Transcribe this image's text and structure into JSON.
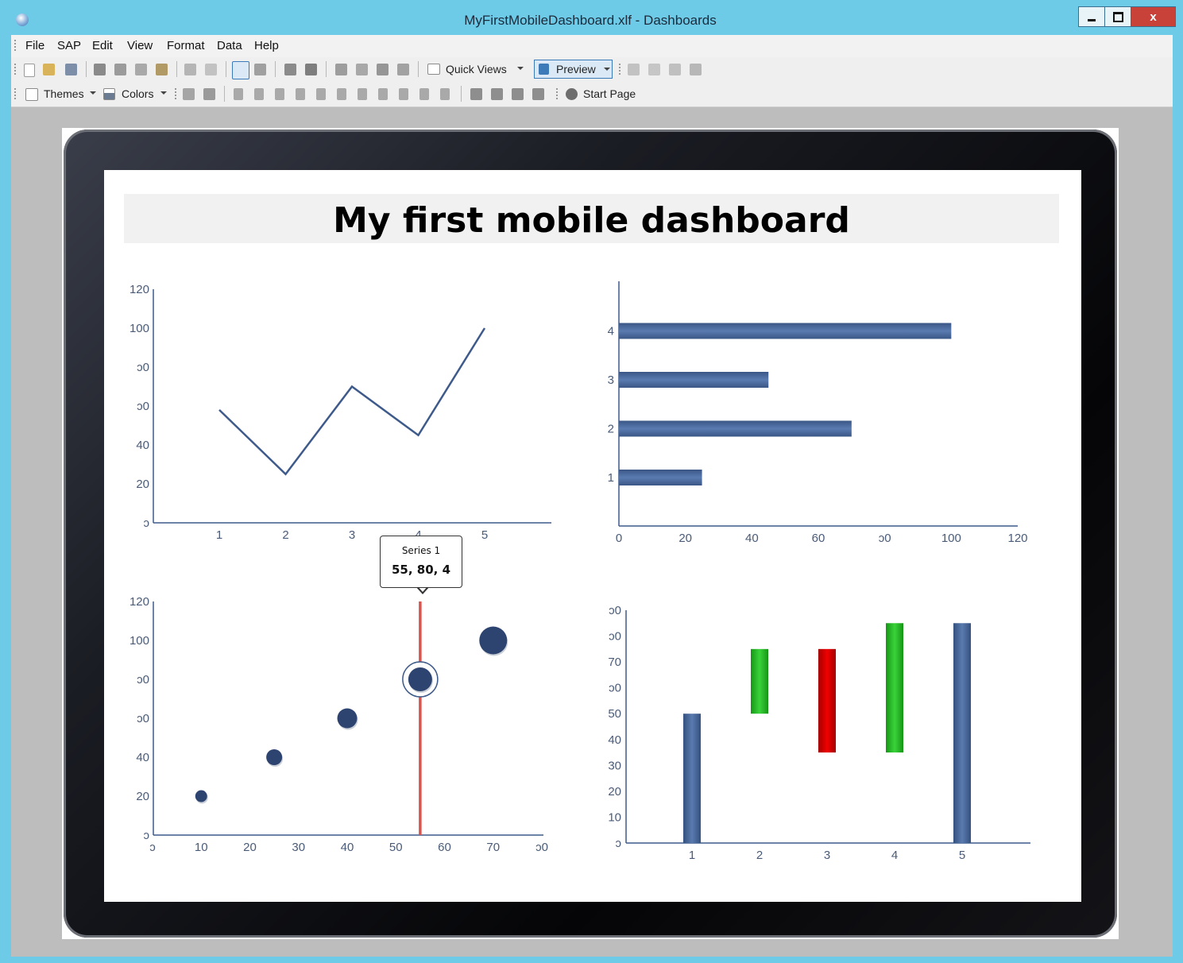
{
  "window": {
    "title": "MyFirstMobileDashboard.xlf - Dashboards",
    "close_label": "x"
  },
  "menu": [
    "File",
    "SAP",
    "Edit",
    "View",
    "Format",
    "Data",
    "Help"
  ],
  "toolbar1": {
    "quick_views": "Quick Views",
    "preview": "Preview"
  },
  "toolbar2": {
    "themes": "Themes",
    "colors": "Colors",
    "start_page": "Start Page"
  },
  "dashboard": {
    "title": "My first mobile dashboard",
    "tooltip": {
      "series": "Series 1",
      "value": "55, 80, 4"
    }
  },
  "colors": {
    "series": "#3d5a8a",
    "bar": "#4a6a9e",
    "up": "#22b422",
    "down": "#d40000",
    "marker_line": "#d9534f"
  },
  "chart_data": [
    {
      "type": "line",
      "x": [
        1,
        2,
        3,
        4,
        5
      ],
      "y": [
        58,
        25,
        70,
        45,
        100
      ],
      "xticks": [
        "1",
        "2",
        "3",
        "4",
        "5"
      ],
      "yticks": [
        "0",
        "20",
        "40",
        "60",
        "80",
        "100",
        "120"
      ],
      "ytick_labels": [
        "ↄ",
        "20",
        "40",
        "ↄ0",
        "ↄ0",
        "100",
        "120"
      ],
      "ylim": [
        0,
        120
      ]
    },
    {
      "type": "bar",
      "orientation": "horizontal",
      "categories": [
        "1",
        "2",
        "3",
        "4"
      ],
      "values": [
        25,
        70,
        45,
        100
      ],
      "xticks": [
        "0",
        "20",
        "40",
        "60",
        "80",
        "100",
        "120"
      ],
      "xtick_labels": [
        "0",
        "20",
        "40",
        "60",
        "ↄ0",
        "100",
        "120"
      ],
      "xlim": [
        0,
        120
      ]
    },
    {
      "type": "scatter",
      "points": [
        {
          "x": 10,
          "y": 20,
          "z": 1
        },
        {
          "x": 25,
          "y": 40,
          "z": 2
        },
        {
          "x": 40,
          "y": 60,
          "z": 3
        },
        {
          "x": 55,
          "y": 80,
          "z": 4
        },
        {
          "x": 70,
          "y": 100,
          "z": 5
        }
      ],
      "highlight_x": 55,
      "xticks": [
        "0",
        "10",
        "20",
        "30",
        "40",
        "50",
        "60",
        "70",
        "80"
      ],
      "xtick_labels": [
        "ↄ",
        "10",
        "20",
        "30",
        "40",
        "50",
        "60",
        "70",
        "ↄ0"
      ],
      "yticks": [
        "0",
        "20",
        "40",
        "60",
        "80",
        "100",
        "120"
      ],
      "ytick_labels": [
        "ↄ",
        "20",
        "40",
        "ↄ0",
        "ↄ0",
        "100",
        "120"
      ],
      "xlim": [
        0,
        80
      ],
      "ylim": [
        0,
        120
      ]
    },
    {
      "type": "waterfall",
      "categories": [
        "1",
        "2",
        "3",
        "4",
        "5"
      ],
      "bars": [
        {
          "from": 0,
          "to": 50,
          "kind": "total"
        },
        {
          "from": 50,
          "to": 75,
          "kind": "up"
        },
        {
          "from": 75,
          "to": 35,
          "kind": "down"
        },
        {
          "from": 35,
          "to": 85,
          "kind": "up"
        },
        {
          "from": 0,
          "to": 85,
          "kind": "total"
        }
      ],
      "yticks": [
        "0",
        "10",
        "20",
        "30",
        "40",
        "50",
        "60",
        "70",
        "80",
        "90"
      ],
      "ytick_labels": [
        "ↄ",
        "10",
        "20",
        "30",
        "40",
        "50",
        "ↄ0",
        "70",
        "ↄ0",
        "ↄ0"
      ],
      "ylim": [
        0,
        90
      ]
    }
  ]
}
